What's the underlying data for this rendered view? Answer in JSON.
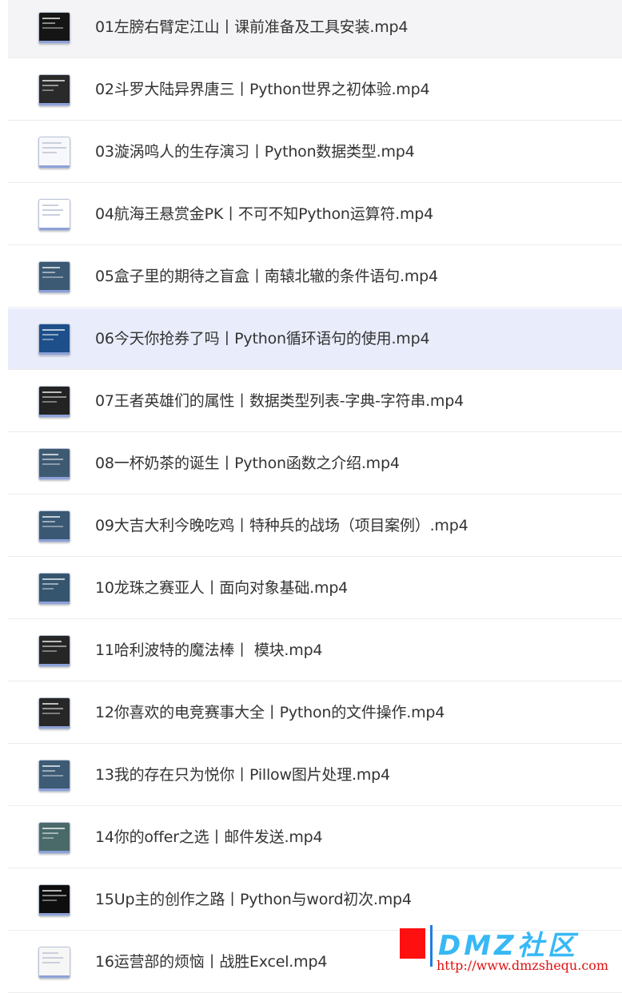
{
  "files": [
    {
      "name": "01左膀右臂定江山丨课前准备及工具安装.mp4",
      "thumb": "#151515",
      "light": false,
      "highlight": "grey"
    },
    {
      "name": "02斗罗大陆异界唐三丨Python世界之初体验.mp4",
      "thumb": "#2a2a2a",
      "light": false,
      "highlight": ""
    },
    {
      "name": "03漩涡鸣人的生存演习丨Python数据类型.mp4",
      "thumb": "#f7f8fb",
      "light": true,
      "highlight": ""
    },
    {
      "name": "04航海王悬赏金PK丨不可不知Python运算符.mp4",
      "thumb": "#ffffff",
      "light": true,
      "highlight": ""
    },
    {
      "name": "05盒子里的期待之盲盒丨南辕北辙的条件语句.mp4",
      "thumb": "#3c5a74",
      "light": false,
      "highlight": ""
    },
    {
      "name": "06今天你抢券了吗丨Python循环语句的使用.mp4",
      "thumb": "#1d4f8a",
      "light": false,
      "highlight": "blue"
    },
    {
      "name": "07王者英雄们的属性丨数据类型列表-字典-字符串.mp4",
      "thumb": "#232323",
      "light": false,
      "highlight": ""
    },
    {
      "name": "08一杯奶茶的诞生丨Python函数之介绍.mp4",
      "thumb": "#3e5a72",
      "light": false,
      "highlight": ""
    },
    {
      "name": "09大吉大利今晚吃鸡丨特种兵的战场（项目案例）.mp4",
      "thumb": "#3a5873",
      "light": false,
      "highlight": ""
    },
    {
      "name": "10龙珠之赛亚人丨面向对象基础.mp4",
      "thumb": "#35556f",
      "light": false,
      "highlight": ""
    },
    {
      "name": "11哈利波特的魔法棒丨 模块.mp4",
      "thumb": "#262626",
      "light": false,
      "highlight": ""
    },
    {
      "name": "12你喜欢的电竞赛事大全丨Python的文件操作.mp4",
      "thumb": "#272727",
      "light": false,
      "highlight": ""
    },
    {
      "name": "13我的存在只为悦你丨Pillow图片处理.mp4",
      "thumb": "#3d5b74",
      "light": false,
      "highlight": ""
    },
    {
      "name": "14你的offer之选丨邮件发送.mp4",
      "thumb": "#4a6a6a",
      "light": false,
      "highlight": ""
    },
    {
      "name": "15Up主的创作之路丨Python与word初次.mp4",
      "thumb": "#0e0e0e",
      "light": false,
      "highlight": ""
    },
    {
      "name": "16运营部的烦恼丨战胜Excel.mp4",
      "thumb": "#f6f6f6",
      "light": true,
      "highlight": ""
    }
  ],
  "watermark": {
    "logo": "DMZ社区",
    "url": "http://www.dmzshequ.com"
  }
}
